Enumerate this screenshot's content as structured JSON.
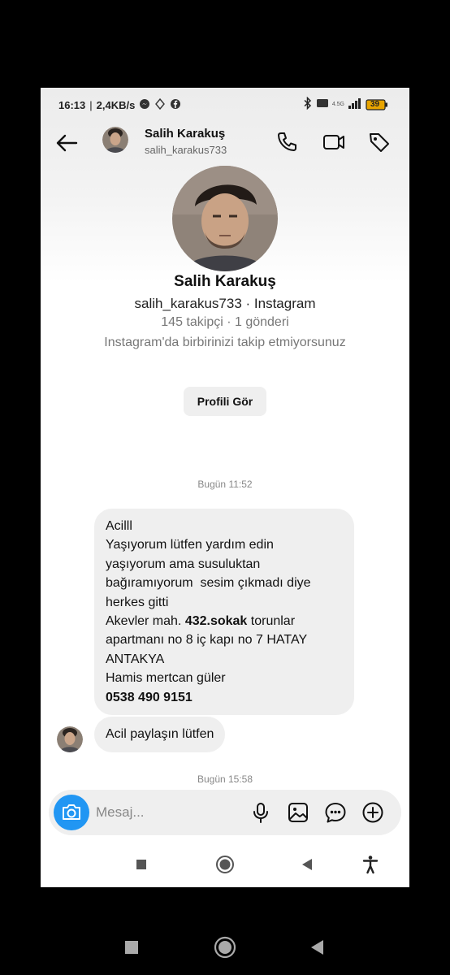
{
  "status_bar": {
    "time": "16:13",
    "speed": "2,4KB/s",
    "network": "4.5G",
    "battery_level": "39",
    "left_icons": [
      "messenger-icon",
      "navigation-icon",
      "facebook-icon"
    ],
    "right_icons": [
      "bluetooth-icon",
      "network-icon",
      "signal-icon",
      "battery-icon"
    ]
  },
  "header": {
    "name": "Salih Karakuş",
    "username": "salih_karakus733",
    "icons": [
      "back-arrow-icon",
      "phone-icon",
      "video-call-icon",
      "tag-icon"
    ]
  },
  "profile": {
    "name": "Salih Karakuş",
    "handle": "salih_karakus733 · Instagram",
    "stats": "145 takipçi · 1 gönderi",
    "follow_note": "Instagram'da birbirinizi takip etmiyorsunuz",
    "view_profile": "Profili Gör"
  },
  "messages": {
    "timestamp1": "Bugün 11:52",
    "main_message": {
      "l1": "Acilll",
      "l2": "Yaşıyorum lütfen yardım edin",
      "l3": "yaşıyorum ama susuluktan",
      "l4": "bağıramıyorum  sesim çıkmadı diye",
      "l5": "herkes gitti",
      "l6_pre": "Akevler mah. ",
      "l6_bold": "432.sokak",
      "l6_post": " torunlar",
      "l7": "apartmanı no 8 iç kapı no 7 HATAY",
      "l8": "ANTAKYA",
      "l9": "Hamis mertcan güler",
      "l10": "0538 490 9151"
    },
    "small_message": "Acil paylaşın lütfen",
    "timestamp2": "Bugün 15:58"
  },
  "composer": {
    "placeholder": "Mesaj...",
    "icons": [
      "camera-icon",
      "microphone-icon",
      "gallery-icon",
      "sticker-icon",
      "add-icon"
    ]
  },
  "colors": {
    "accent": "#2196f3",
    "bubble": "#efefef",
    "meta_text": "#888888"
  },
  "system_nav": {
    "icons": [
      "recents-icon",
      "home-icon",
      "back-icon",
      "accessibility-icon"
    ]
  },
  "outer_nav": {
    "icons": [
      "recents-icon",
      "home-icon",
      "back-icon"
    ]
  }
}
